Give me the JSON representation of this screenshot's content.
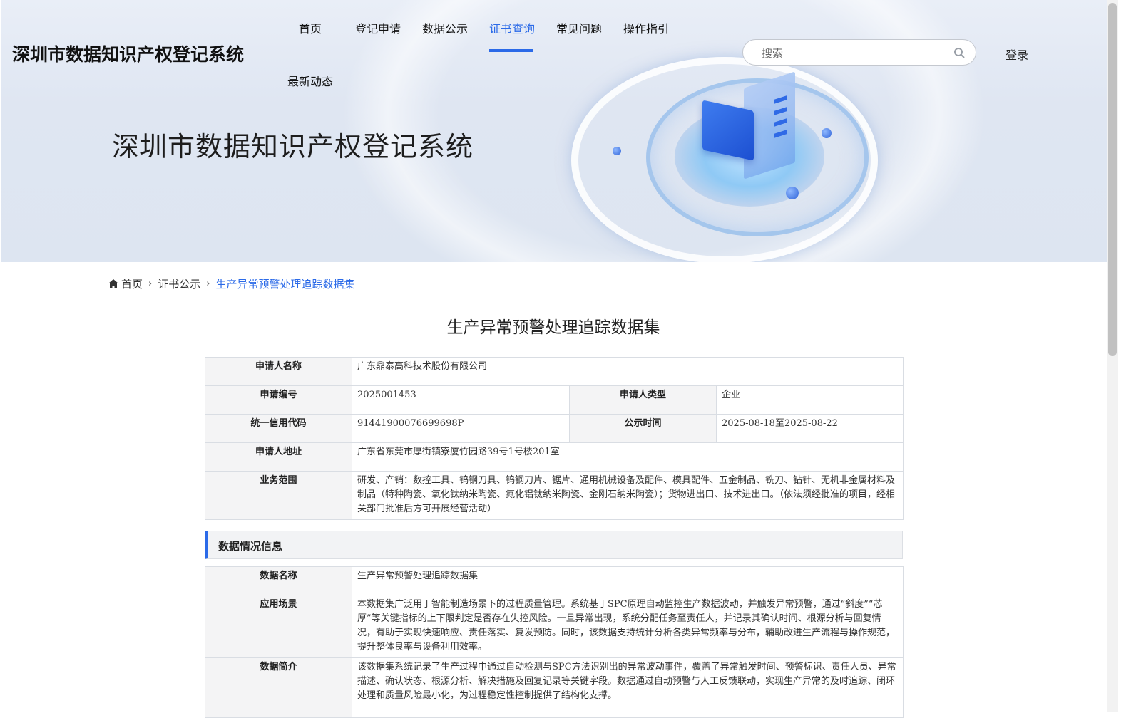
{
  "header": {
    "site_title": "深圳市数据知识产权登记系统",
    "nav": [
      {
        "label": "首页"
      },
      {
        "label": "登记申请"
      },
      {
        "label": "数据公示"
      },
      {
        "label": "证书查询",
        "active": true
      },
      {
        "label": "常见问题"
      },
      {
        "label": "操作指引"
      },
      {
        "label": "最新动态"
      }
    ],
    "search_placeholder": "搜索",
    "login_label": "登录"
  },
  "banner": {
    "title": "深圳市数据知识产权登记系统"
  },
  "breadcrumb": {
    "home": "首页",
    "level2": "证书公示",
    "current": "生产异常预警处理追踪数据集"
  },
  "page_title": "生产异常预警处理追踪数据集",
  "applicant": {
    "name_label": "申请人名称",
    "name": "广东鼎泰高科技术股份有限公司",
    "app_no_label": "申请编号",
    "app_no": "2025001453",
    "type_label": "申请人类型",
    "type": "企业",
    "credit_label": "统一信用代码",
    "credit": "91441900076699698P",
    "pub_label": "公示时间",
    "pub": "2025-08-18至2025-08-22",
    "address_label": "申请人地址",
    "address": "广东省东莞市厚街镇寮厦竹园路39号1号楼201室",
    "scope_label": "业务范围",
    "scope": "研发、产销：数控工具、钨钢刀具、钨钢刀片、锯片、通用机械设备及配件、模具配件、五金制品、铣刀、钻针、无机非金属材料及制品（特种陶瓷、氧化钛纳米陶瓷、氮化铝钛纳米陶瓷、金刚石纳米陶瓷）；货物进出口、技术进出口。（依法须经批准的项目，经相关部门批准后方可开展经营活动）"
  },
  "data_section": {
    "heading": "数据情况信息",
    "name_label": "数据名称",
    "name": "生产异常预警处理追踪数据集",
    "scene_label": "应用场景",
    "scene": "本数据集广泛用于智能制造场景下的过程质量管理。系统基于SPC原理自动监控生产数据波动，并触发异常预警，通过“斜度”“芯厚”等关键指标的上下限判定是否存在失控风险。一旦异常出现，系统分配任务至责任人，并记录其确认时间、根源分析与回复情况，有助于实现快速响应、责任落实、复发预防。同时，该数据支持统计分析各类异常频率与分布，辅助改进生产流程与操作规范，提升整体良率与设备利用效率。",
    "intro_label": "数据简介",
    "intro": "该数据集系统记录了生产过程中通过自动检测与SPC方法识别出的异常波动事件，覆盖了异常触发时间、预警标识、责任人员、异常描述、确认状态、根源分析、解决措施及回复记录等关键字段。数据通过自动预警与人工反馈联动，实现生产异常的及时追踪、闭环处理和质量风险最小化，为过程稳定性控制提供了结构化支撑。"
  },
  "colors": {
    "accent": "#2b6ae8"
  }
}
